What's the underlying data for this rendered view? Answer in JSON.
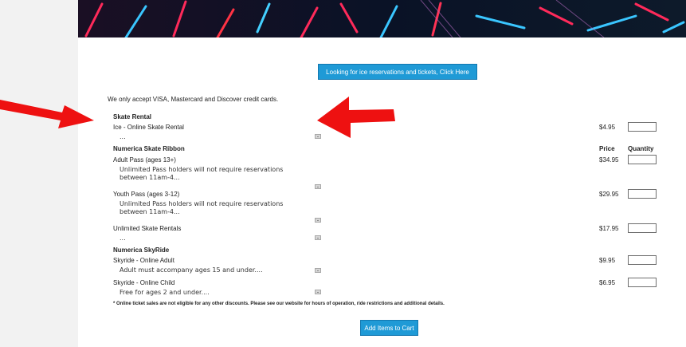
{
  "header": {
    "reservations_button": "Looking for ice reservations and tickets, Click Here"
  },
  "notice": "We only accept VISA, Mastercard and Discover credit cards.",
  "columns": {
    "price": "Price",
    "quantity": "Quantity"
  },
  "sections": [
    {
      "title": "Skate Rental",
      "items": [
        {
          "name": "Ice - Online Skate Rental",
          "desc": "...",
          "price": "$4.95"
        }
      ]
    },
    {
      "title": "Numerica Skate Ribbon",
      "items": [
        {
          "name": "Adult Pass (ages 13+)",
          "desc": "Unlimited Pass holders will not require reservations between 11am-4...",
          "price": "$34.95"
        },
        {
          "name": "Youth Pass (ages 3-12)",
          "desc": "Unlimited Pass holders will not require reservations between 11am-4...",
          "price": "$29.95"
        },
        {
          "name": "Unlimited Skate Rentals",
          "desc": "...",
          "price": "$17.95"
        }
      ]
    },
    {
      "title": "Numerica SkyRide",
      "items": [
        {
          "name": "Skyride - Online Adult",
          "desc": "Adult must accompany ages 15 and under....",
          "price": "$9.95"
        },
        {
          "name": "Skyride - Online Child",
          "desc": "Free for ages 2 and under....",
          "price": "$6.95"
        }
      ]
    }
  ],
  "disclaimer": "* Online ticket sales are not eligible for any other discounts. Please see our website for hours of operation, ride restrictions and additional details.",
  "cart_button": "Add Items to Cart",
  "colors": {
    "button": "#1f9ad6",
    "arrow": "#ee1111"
  },
  "icons": {
    "arrow": "red-arrow-icon",
    "info": "info-icon"
  }
}
